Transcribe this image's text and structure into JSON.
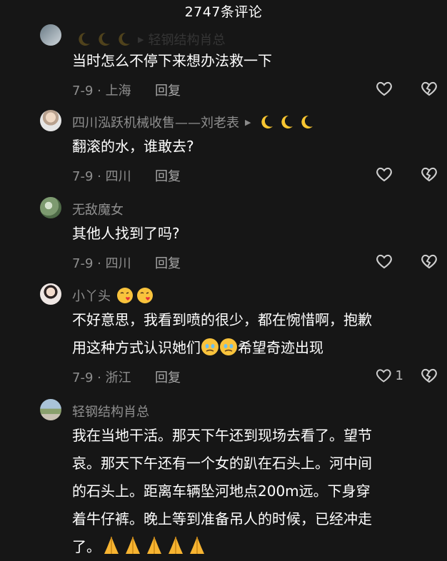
{
  "header": {
    "title": "2747条评论"
  },
  "comments": [
    {
      "name": "轻钢结构肖总",
      "text": "当时怎么不停下来想办法救一下",
      "meta": "7-9 · 上海",
      "reply": "回复",
      "likes": ""
    },
    {
      "name": "四川泓跃机械收售——刘老表",
      "text": "翻滚的水，谁敢去?",
      "meta": "7-9 · 四川",
      "reply": "回复",
      "likes": ""
    },
    {
      "name": "无敌魔女",
      "text": "其他人找到了吗?",
      "meta": "7-9 · 四川",
      "reply": "回复",
      "likes": ""
    },
    {
      "name": "小丫头",
      "text_line1": "不好意思，我看到喷的很少，都在惋惜啊，抱歉",
      "text_line2a": "用这种方式认识她们",
      "text_line2b": "希望奇迹出现",
      "meta": "7-9 · 浙江",
      "reply": "回复",
      "likes": "1"
    },
    {
      "name": "轻钢结构肖总",
      "lines": [
        "我在当地干活。那天下午还到现场去看了。望节",
        "哀。那天下午还有一个女的趴在石头上。河中间",
        "的石头上。距离车辆坠河地点200m远。下身穿",
        "着牛仔裤。晚上等到准备吊人的时候，已经冲走",
        "了。"
      ]
    }
  ],
  "icons": {
    "like": "heart-outline-icon",
    "dislike": "broken-heart-icon",
    "moon": "crescent-moon-emoji",
    "pray": "folded-hands-emoji",
    "kiss": "face-blowing-kiss-emoji",
    "teary": "face-holding-back-tears-emoji"
  },
  "colors": {
    "background": "#161616",
    "text": "#ffffff",
    "muted": "#8f8f8f"
  }
}
